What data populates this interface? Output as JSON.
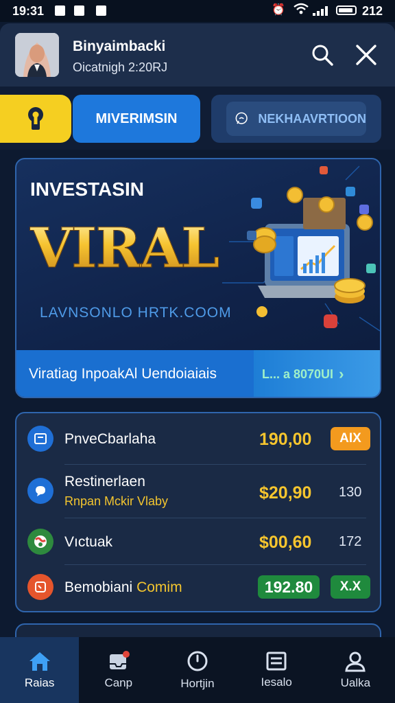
{
  "status_bar": {
    "time": "19:31",
    "battery": "212"
  },
  "header": {
    "user_name": "Binyaimbacki",
    "user_sub": "Oicatnigh 2:20RJ",
    "search_icon": "search-icon",
    "close_icon": "close-icon"
  },
  "segments": {
    "key_icon": "keyhole-icon",
    "active_label": "MIVERIMSIN",
    "secondary_label": "NEKHAAVRTIOON"
  },
  "banner": {
    "kicker": "INVESTASIN",
    "title": "VIRAL",
    "url": "LAVNSONLO HRTK.COOM",
    "cta_label": "Viratiag InpoakAl Uendoiaiais",
    "cta_value": "L... a 8070UI"
  },
  "list": {
    "rows": [
      {
        "name": "PnveCbarlaha",
        "sub": "",
        "amount": "190,00",
        "tag": "AIX",
        "icon": "wallet-icon"
      },
      {
        "name": "Restinerlaen",
        "sub": "Rnpan Mckir Vlaby",
        "amount": "$20,90",
        "tag": "130",
        "icon": "chat-icon"
      },
      {
        "name": "Vıctuak",
        "sub": "",
        "amount": "$00,60",
        "tag": "172",
        "icon": "globe-icon"
      },
      {
        "name": "Bemobiani",
        "name_suffix": "Comim",
        "sub": "",
        "amount": "192.80",
        "tag": "X.X",
        "icon": "tag-icon"
      }
    ]
  },
  "nav": [
    {
      "label": "Raias",
      "icon": "home-icon"
    },
    {
      "label": "Canp",
      "icon": "inbox-icon"
    },
    {
      "label": "Hortjin",
      "icon": "clock-icon"
    },
    {
      "label": "Iesalo",
      "icon": "list-icon"
    },
    {
      "label": "Ualka",
      "icon": "profile-icon"
    }
  ],
  "colors": {
    "accent_blue": "#1e78dc",
    "gold": "#f6c52e",
    "key_yellow": "#f5cf21",
    "tag_orange": "#f39a1e",
    "tag_green": "#1f8a3d"
  }
}
